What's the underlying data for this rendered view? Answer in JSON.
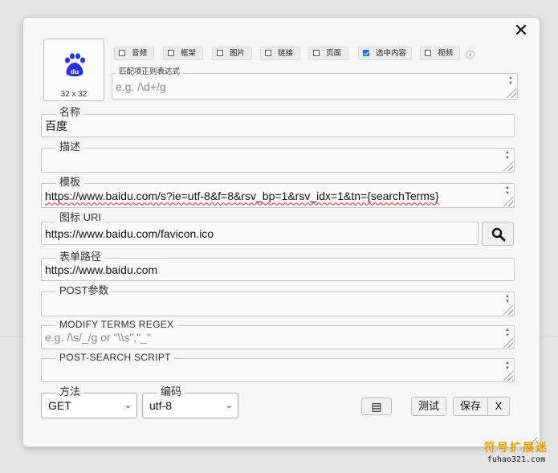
{
  "dialog": {
    "close_label": "✕",
    "icon_size": "32 x 32",
    "icon_logo": "du",
    "checkboxes": [
      {
        "label": "音频",
        "checked": false
      },
      {
        "label": "框架",
        "checked": false
      },
      {
        "label": "图片",
        "checked": false
      },
      {
        "label": "链接",
        "checked": false
      },
      {
        "label": "页面",
        "checked": false
      },
      {
        "label": "选中内容",
        "checked": true
      },
      {
        "label": "视频",
        "checked": false
      }
    ],
    "info_glyph": "ⓘ",
    "regex": {
      "label": "匹配项正则表达式",
      "placeholder": "e.g. /\\d+/g"
    },
    "name": {
      "label": "名称",
      "value": "百度"
    },
    "description": {
      "label": "描述",
      "value": ""
    },
    "template": {
      "label": "模板",
      "value": "https://www.baidu.com/s?ie=utf-8&f=8&rsv_bp=1&rsv_idx=1&tn={searchTerms}"
    },
    "icon_uri": {
      "label": "图标 URI",
      "value": "https://www.baidu.com/favicon.ico"
    },
    "form_path": {
      "label": "表单路径",
      "value": "https://www.baidu.com"
    },
    "post_params": {
      "label": "POST参数",
      "value": ""
    },
    "modify_regex": {
      "label": "Modify Terms Regex",
      "placeholder": "e.g. /\\s/_/g or \"\\\\s\",\"_\""
    },
    "post_script": {
      "label": "Post-Search Script",
      "value": ""
    },
    "method": {
      "label": "方法",
      "value": "GET"
    },
    "encoding": {
      "label": "编码",
      "value": "utf-8"
    },
    "buttons": {
      "copy_icon": "▤",
      "test": "测试",
      "save": "保存",
      "cancel": "X"
    }
  },
  "watermark": {
    "line1": "符号扩展迷",
    "line2": "fuhao321.com"
  },
  "colors": {
    "accent": "#1a73e8",
    "baidu_blue": "#2932e1",
    "watermark": "#e6a400"
  }
}
